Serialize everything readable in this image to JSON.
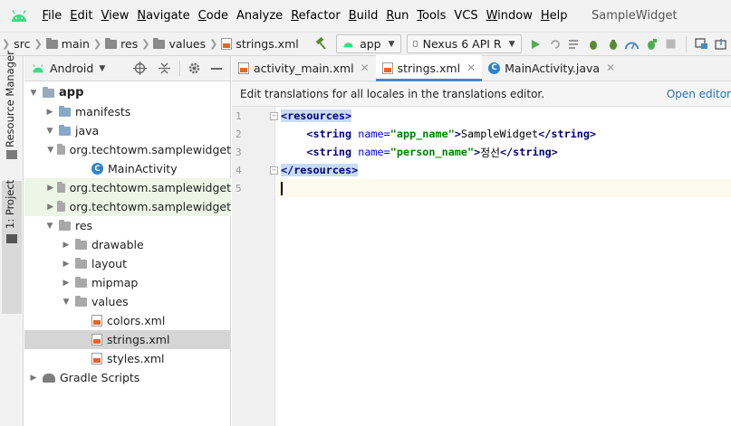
{
  "menubar": {
    "items": [
      {
        "mnemonic": "F",
        "rest": "ile"
      },
      {
        "mnemonic": "E",
        "rest": "dit"
      },
      {
        "mnemonic": "V",
        "rest": "iew"
      },
      {
        "mnemonic": "N",
        "rest": "avigate"
      },
      {
        "mnemonic": "C",
        "rest": "ode"
      },
      {
        "mnemonic": "",
        "rest": "Analyze"
      },
      {
        "mnemonic": "R",
        "rest": "efactor"
      },
      {
        "mnemonic": "B",
        "rest": "uild"
      },
      {
        "mnemonic": "R",
        "rest": "un"
      },
      {
        "mnemonic": "T",
        "rest": "ools"
      },
      {
        "mnemonic": "",
        "rest": "VCS"
      },
      {
        "mnemonic": "W",
        "rest": "indow"
      },
      {
        "mnemonic": "H",
        "rest": "elp"
      }
    ],
    "window_title": "SampleWidget"
  },
  "toolbar": {
    "breadcrumb": [
      "src",
      "main",
      "res",
      "values",
      "strings.xml"
    ],
    "run_config": "app",
    "device": "Nexus 6 API R"
  },
  "stripe": {
    "resource_manager": "Resource Manager",
    "project_tab": "1: Project"
  },
  "panel": {
    "view_mode": "Android",
    "tree": [
      {
        "label": "app",
        "depth": 0,
        "twisty": "open",
        "icon": "app",
        "bold": true
      },
      {
        "label": "manifests",
        "depth": 1,
        "twisty": "closed",
        "icon": "folder-blue"
      },
      {
        "label": "java",
        "depth": 1,
        "twisty": "open",
        "icon": "folder-blue"
      },
      {
        "label": "org.techtowm.samplewidget",
        "depth": 2,
        "twisty": "open",
        "icon": "folder-gray"
      },
      {
        "label": "MainActivity",
        "depth": 3,
        "twisty": "none",
        "icon": "class"
      },
      {
        "label": "org.techtowm.samplewidget",
        "depth": 2,
        "twisty": "closed",
        "icon": "folder-gray",
        "highlight": true
      },
      {
        "label": "org.techtowm.samplewidget",
        "depth": 2,
        "twisty": "closed",
        "icon": "folder-gray",
        "highlight": true
      },
      {
        "label": "res",
        "depth": 1,
        "twisty": "open",
        "icon": "folder-gray"
      },
      {
        "label": "drawable",
        "depth": 2,
        "twisty": "closed",
        "icon": "folder-gray"
      },
      {
        "label": "layout",
        "depth": 2,
        "twisty": "closed",
        "icon": "folder-gray"
      },
      {
        "label": "mipmap",
        "depth": 2,
        "twisty": "closed",
        "icon": "folder-gray"
      },
      {
        "label": "values",
        "depth": 2,
        "twisty": "open",
        "icon": "folder-gray"
      },
      {
        "label": "colors.xml",
        "depth": 3,
        "twisty": "none",
        "icon": "xml"
      },
      {
        "label": "strings.xml",
        "depth": 3,
        "twisty": "none",
        "icon": "xml",
        "selected": true
      },
      {
        "label": "styles.xml",
        "depth": 3,
        "twisty": "none",
        "icon": "xml"
      },
      {
        "label": "Gradle Scripts",
        "depth": 0,
        "twisty": "closed",
        "icon": "gradle"
      }
    ]
  },
  "editor": {
    "tabs": [
      {
        "label": "activity_main.xml",
        "icon": "xml",
        "active": false
      },
      {
        "label": "strings.xml",
        "icon": "xml",
        "active": true
      },
      {
        "label": "MainActivity.java",
        "icon": "class",
        "active": false
      }
    ],
    "notice": {
      "text": "Edit translations for all locales in the translations editor.",
      "link": "Open editor"
    },
    "line_numbers": [
      "1",
      "2",
      "3",
      "4",
      "5"
    ],
    "code": {
      "open_tag": "<resources>",
      "line2": {
        "tag": "<string",
        "attr": "name",
        "eq": "=",
        "value": "\"app_name\"",
        "close": ">",
        "text": "SampleWidget",
        "end": "</string>"
      },
      "line3": {
        "tag": "<string",
        "attr": "name",
        "eq": "=",
        "value": "\"person_name\"",
        "close": ">",
        "text": "정선",
        "end": "</string>"
      },
      "close_tag": "</resources>"
    }
  },
  "colors": {
    "android_green": "#3ddc84",
    "run_green": "#4caf50",
    "accent_blue": "#4a88c7",
    "xml_orange": "#e0662a"
  }
}
